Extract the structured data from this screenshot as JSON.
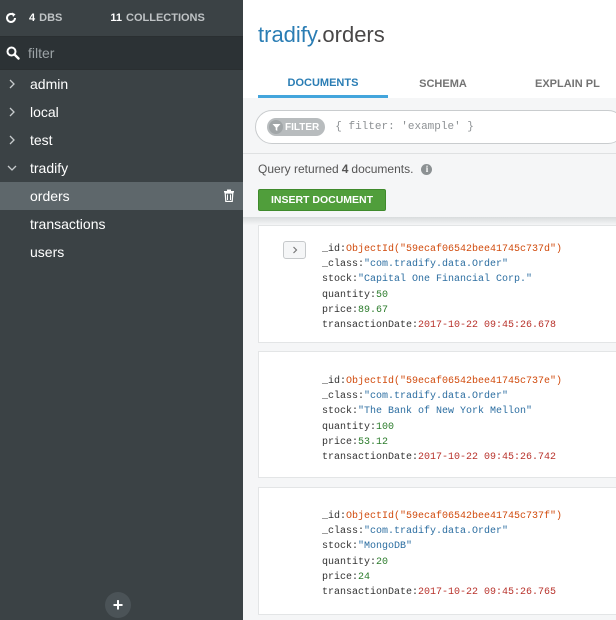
{
  "sidebar": {
    "dbs_count": "4",
    "dbs_label": "DBS",
    "collections_count": "11",
    "collections_label": "COLLECTIONS",
    "filter_placeholder": "filter",
    "databases": [
      {
        "name": "admin"
      },
      {
        "name": "local"
      },
      {
        "name": "test"
      },
      {
        "name": "tradify"
      }
    ],
    "collections": [
      {
        "name": "orders"
      },
      {
        "name": "transactions"
      },
      {
        "name": "users"
      }
    ],
    "add_label": "+"
  },
  "header": {
    "db_name": "tradify",
    "collection_name": ".orders"
  },
  "tabs": [
    {
      "label": "DOCUMENTS"
    },
    {
      "label": "SCHEMA"
    },
    {
      "label": "EXPLAIN PL"
    }
  ],
  "query": {
    "filter_label": "FILTER",
    "placeholder": "{ filter: 'example' }"
  },
  "results": {
    "prefix": "Query returned",
    "count": "4",
    "suffix": "documents."
  },
  "insert_button": "INSERT DOCUMENT",
  "documents": [
    {
      "id_key": "_id:",
      "id_value": "ObjectId(\"59ecaf06542bee41745c737d\")",
      "class_key": "_class:",
      "class_value": "\"com.tradify.data.Order\"",
      "stock_key": "stock:",
      "stock_value": "\"Capital One Financial Corp.\"",
      "qty_key": "quantity:",
      "qty_value": "50",
      "price_key": "price:",
      "price_value": "89.67",
      "date_key": "transactionDate:",
      "date_value": "2017-10-22 09:45:26.678"
    },
    {
      "id_key": "_id:",
      "id_value": "ObjectId(\"59ecaf06542bee41745c737e\")",
      "class_key": "_class:",
      "class_value": "\"com.tradify.data.Order\"",
      "stock_key": "stock:",
      "stock_value": "\"The Bank of New York Mellon\"",
      "qty_key": "quantity:",
      "qty_value": "100",
      "price_key": "price:",
      "price_value": "53.12",
      "date_key": "transactionDate:",
      "date_value": "2017-10-22 09:45:26.742"
    },
    {
      "id_key": "_id:",
      "id_value": "ObjectId(\"59ecaf06542bee41745c737f\")",
      "class_key": "_class:",
      "class_value": "\"com.tradify.data.Order\"",
      "stock_key": "stock:",
      "stock_value": "\"MongoDB\"",
      "qty_key": "quantity:",
      "qty_value": "20",
      "price_key": "price:",
      "price_value": "24",
      "date_key": "transactionDate:",
      "date_value": "2017-10-22 09:45:26.765"
    }
  ],
  "colors": {
    "accent": "#2a7db4",
    "insert_green": "#509e3b",
    "sidebar_bg": "#3b4245"
  }
}
